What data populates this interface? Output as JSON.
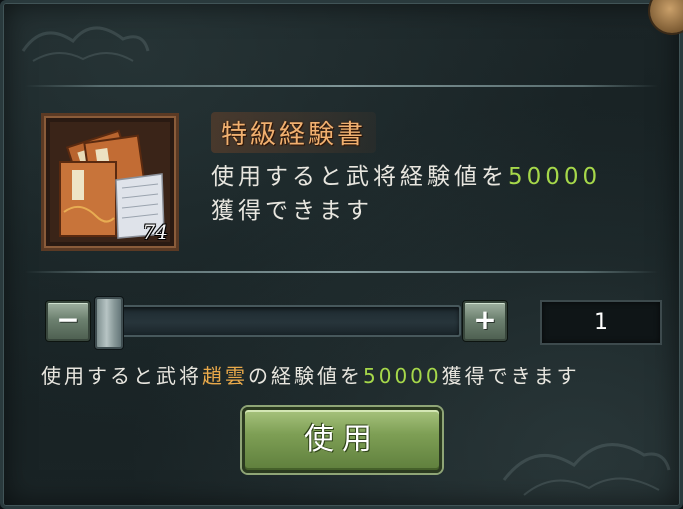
{
  "item": {
    "name": "特級経験書",
    "count": "74",
    "desc_line1_prefix": "使用すると武将経験値を",
    "desc_exp_value": "50000",
    "desc_line2": "獲得できます",
    "icon": "experience-book-icon"
  },
  "controls": {
    "minus_label": "−",
    "plus_label": "+",
    "quantity": "1",
    "slider_fraction": 0
  },
  "summary": {
    "part1": "使用すると武将",
    "general_name": "趙雲",
    "part2": "の経験値を",
    "exp_value": "50000",
    "part3": "獲得できます"
  },
  "use_button": {
    "label": "使用"
  },
  "colors": {
    "title": "#f0b070",
    "highlight_green": "#a6d84a",
    "highlight_gold": "#e9a94a",
    "button_green": "#7e9f55"
  }
}
